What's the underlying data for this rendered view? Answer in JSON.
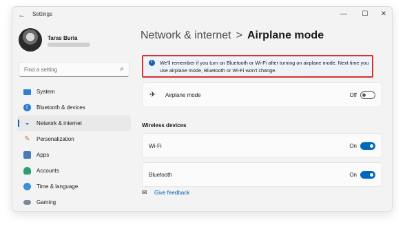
{
  "window": {
    "app_title": "Settings",
    "back_glyph": "←",
    "minimize_glyph": "—",
    "maximize_glyph": "☐",
    "close_glyph": "✕"
  },
  "profile": {
    "name": "Taras Buria"
  },
  "search": {
    "placeholder": "Find a setting",
    "icon": "search-icon",
    "icon_glyph": "⌕"
  },
  "sidebar": {
    "items": [
      {
        "label": "System",
        "icon": "system-icon"
      },
      {
        "label": "Bluetooth & devices",
        "icon": "bluetooth-icon",
        "glyph": "ᛒ"
      },
      {
        "label": "Network & internet",
        "icon": "wifi-icon",
        "glyph": "◒",
        "active": true
      },
      {
        "label": "Personalization",
        "icon": "brush-icon",
        "glyph": "✎"
      },
      {
        "label": "Apps",
        "icon": "apps-icon"
      },
      {
        "label": "Accounts",
        "icon": "person-icon"
      },
      {
        "label": "Time & language",
        "icon": "globe-clock-icon"
      },
      {
        "label": "Gaming",
        "icon": "gamepad-icon"
      }
    ]
  },
  "breadcrumb": {
    "parent": "Network & internet",
    "separator": ">",
    "current": "Airplane mode"
  },
  "notice": {
    "icon_glyph": "i",
    "text": "We'll remember if you turn on Bluetooth or Wi-Fi after turning on airplane mode. Next time you use airplane mode, Bluetooth or Wi-Fi won't change."
  },
  "airplane": {
    "label": "Airplane mode",
    "icon_glyph": "✈",
    "state": "Off",
    "on": false
  },
  "wireless": {
    "heading": "Wireless devices",
    "wifi": {
      "label": "Wi-Fi",
      "state": "On",
      "on": true
    },
    "bluetooth": {
      "label": "Bluetooth",
      "state": "On",
      "on": true
    }
  },
  "feedback": {
    "label": "Give feedback",
    "icon_glyph": "✉"
  },
  "colors": {
    "accent": "#0067c0",
    "highlight_border": "#d93030",
    "notice_bg": "#eef3fa"
  }
}
